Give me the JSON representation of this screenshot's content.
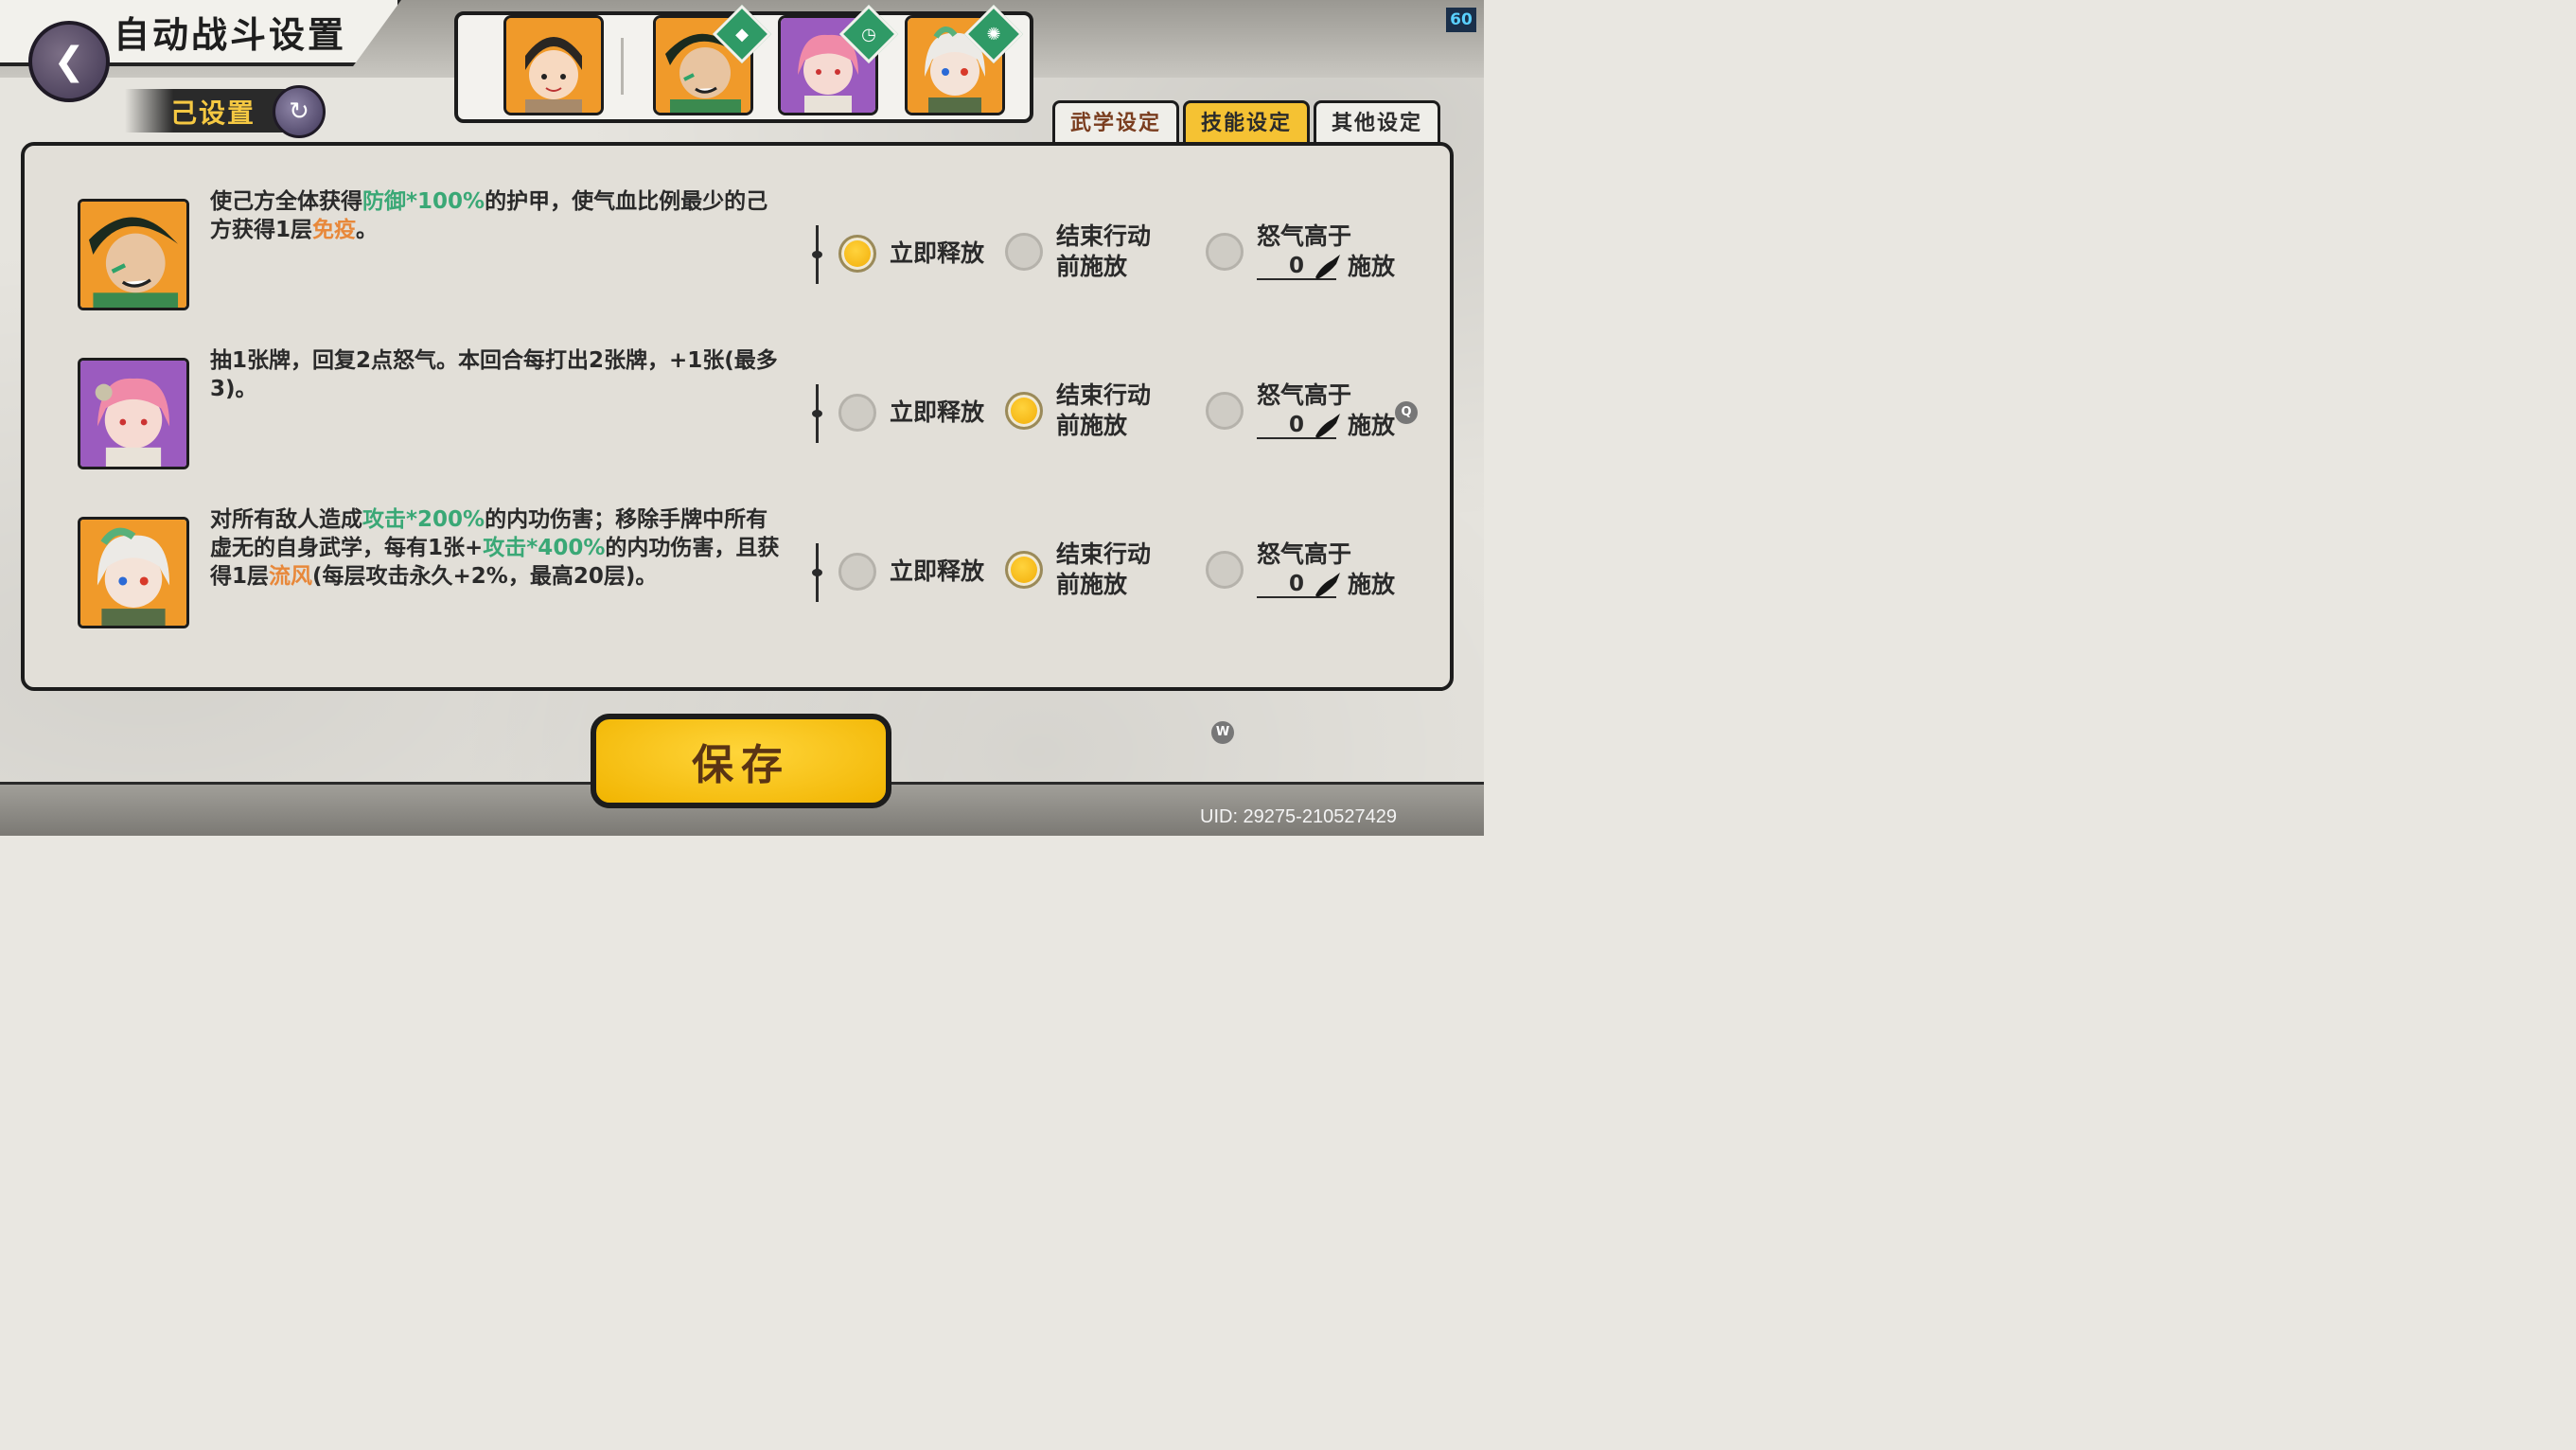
{
  "header": {
    "title": "自动战斗设置",
    "status_label": "己设置",
    "fps": "60"
  },
  "tabs": [
    {
      "label": "武学设定",
      "active": false
    },
    {
      "label": "技能设定",
      "active": true
    },
    {
      "label": "其他设定",
      "active": false
    }
  ],
  "skills": [
    {
      "desc_parts": [
        "使己方全体获得",
        "防御*100%",
        "的护甲，使气血比例最少的己方获得1层",
        "免疫",
        "。"
      ],
      "option_immediate": "立即释放",
      "option_end_line1": "结束行动",
      "option_end_line2": "前施放",
      "option_rage_line1": "怒气高于",
      "rage_value": "0",
      "option_rage_suffix": "施放",
      "selected": "immediate"
    },
    {
      "desc_parts": [
        "抽1张牌，回复2点怒气。本回合每打出2张牌，+1张(最多3)。"
      ],
      "option_immediate": "立即释放",
      "option_end_line1": "结束行动",
      "option_end_line2": "前施放",
      "option_rage_line1": "怒气高于",
      "rage_value": "0",
      "option_rage_suffix": "施放",
      "selected": "end"
    },
    {
      "desc_parts": [
        "对所有敌人造成",
        "攻击*200%",
        "的内功伤害；移除手牌中所有虚无的自身武学，每有1张+",
        "攻击*400%",
        "的内功伤害，且获得1层",
        "流风",
        "(每层攻击永久+2%，最高20层)。"
      ],
      "option_immediate": "立即释放",
      "option_end_line1": "结束行动",
      "option_end_line2": "前施放",
      "option_rage_line1": "怒气高于",
      "rage_value": "0",
      "option_rage_suffix": "施放",
      "selected": "end"
    }
  ],
  "hotkeys": {
    "q": "Q",
    "w": "W"
  },
  "save_label": "保存",
  "uid": "UID:  29275-210527429",
  "colors": {
    "accent_yellow": "#f5c233",
    "highlight_green": "#3aa876",
    "highlight_orange": "#e8883a"
  },
  "team_icons": [
    "portrait-girl-orange",
    "portrait-warrior-green",
    "portrait-pink-hair",
    "portrait-white-hair"
  ]
}
